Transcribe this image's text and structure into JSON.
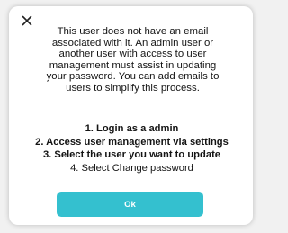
{
  "dialog": {
    "close_icon": "close-icon",
    "message_lines": [
      "This user does not have an email",
      "associated with it. An admin user or",
      "another user with access to user",
      "management must assist in updating",
      "your password. You can add emails to",
      "users to simplify this process."
    ],
    "steps": [
      "1. Login as a admin",
      "2. Access user management via settings",
      "3. Select the user you want to update",
      "4. Select Change password"
    ],
    "ok_label": "Ok",
    "accent_color": "#34c0cf"
  }
}
